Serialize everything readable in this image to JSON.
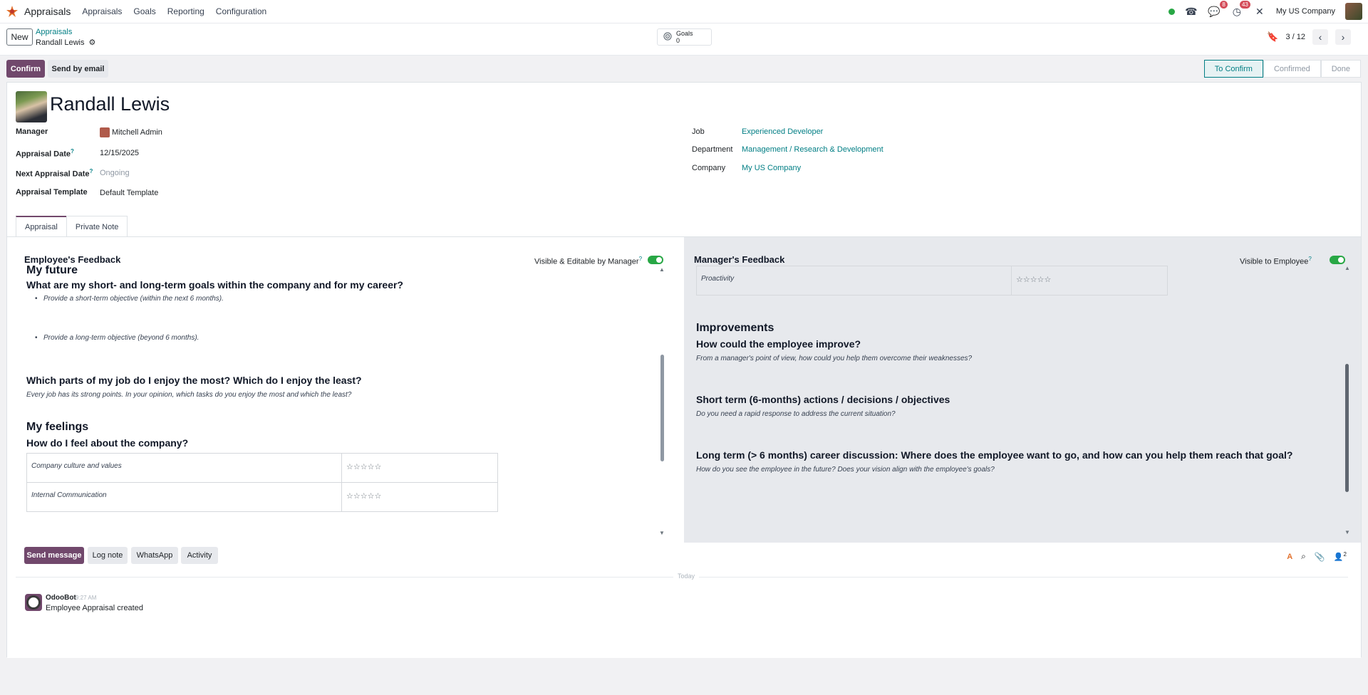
{
  "nav": {
    "app_name": "Appraisals",
    "menu": [
      "Appraisals",
      "Goals",
      "Reporting",
      "Configuration"
    ],
    "messages_badge": "8",
    "activity_badge": "43",
    "company": "My US Company"
  },
  "control": {
    "new_label": "New",
    "breadcrumb_parent": "Appraisals",
    "breadcrumb_current": "Randall Lewis",
    "goals_label": "Goals",
    "goals_count": "0",
    "pager": "3 / 12"
  },
  "actions": {
    "confirm": "Confirm",
    "send_email": "Send by email",
    "stages": [
      "To Confirm",
      "Confirmed",
      "Done"
    ],
    "active_stage": "To Confirm"
  },
  "employee": {
    "name": "Randall Lewis",
    "manager_label": "Manager",
    "manager": "Mitchell Admin",
    "appraisal_date_label": "Appraisal Date",
    "appraisal_date": "12/15/2025",
    "next_appraisal_label": "Next Appraisal Date",
    "next_appraisal": "Ongoing",
    "template_label": "Appraisal Template",
    "template": "Default Template",
    "job_label": "Job",
    "job": "Experienced Developer",
    "department_label": "Department",
    "department": "Management / Research & Development",
    "company_label": "Company",
    "company": "My US Company"
  },
  "tabs": [
    "Appraisal",
    "Private Note"
  ],
  "employee_feedback": {
    "title": "Employee's Feedback",
    "toggle_label": "Visible & Editable by Manager",
    "section_future": "My future",
    "q_goals": "What are my short- and long-term goals within the company and for my career?",
    "bullet_short": "Provide a short-term objective (within the next 6 months).",
    "bullet_long": "Provide a long-term objective (beyond 6 months).",
    "q_enjoy": "Which parts of my job do I enjoy the most? Which do I enjoy the least?",
    "note_enjoy": "Every job has its strong points. In your opinion, which tasks do you enjoy the most and which the least?",
    "section_feelings": "My feelings",
    "q_company": "How do I feel about the company?",
    "rows": [
      {
        "label": "Company culture and values",
        "stars": "☆☆☆☆☆"
      },
      {
        "label": "Internal Communication",
        "stars": "☆☆☆☆☆"
      }
    ]
  },
  "manager_feedback": {
    "title": "Manager's Feedback",
    "toggle_label": "Visible to Employee",
    "row": {
      "label": "Proactivity",
      "stars": "☆☆☆☆☆"
    },
    "section_improvements": "Improvements",
    "q_improve": "How could the employee improve?",
    "note_improve": "From a manager's point of view, how could you help them overcome their weaknesses?",
    "q_short": "Short term (6-months) actions / decisions / objectives",
    "note_short": "Do you need a rapid response to address the current situation?",
    "q_long": "Long term (> 6 months) career discussion: Where does the employee want to go, and how can you help them reach that goal?",
    "note_long": "How do you see the employee in the future? Does your vision align with the employee's goals?"
  },
  "chatter": {
    "send_message": "Send message",
    "log_note": "Log note",
    "whatsapp": "WhatsApp",
    "activity": "Activity",
    "followers_count": "2",
    "today": "Today",
    "author": "OdooBot",
    "time": "9:27 AM",
    "message": "Employee Appraisal created"
  },
  "colors": {
    "brand": "#71486c",
    "link": "#017e84",
    "toggle_on": "#28a745"
  }
}
